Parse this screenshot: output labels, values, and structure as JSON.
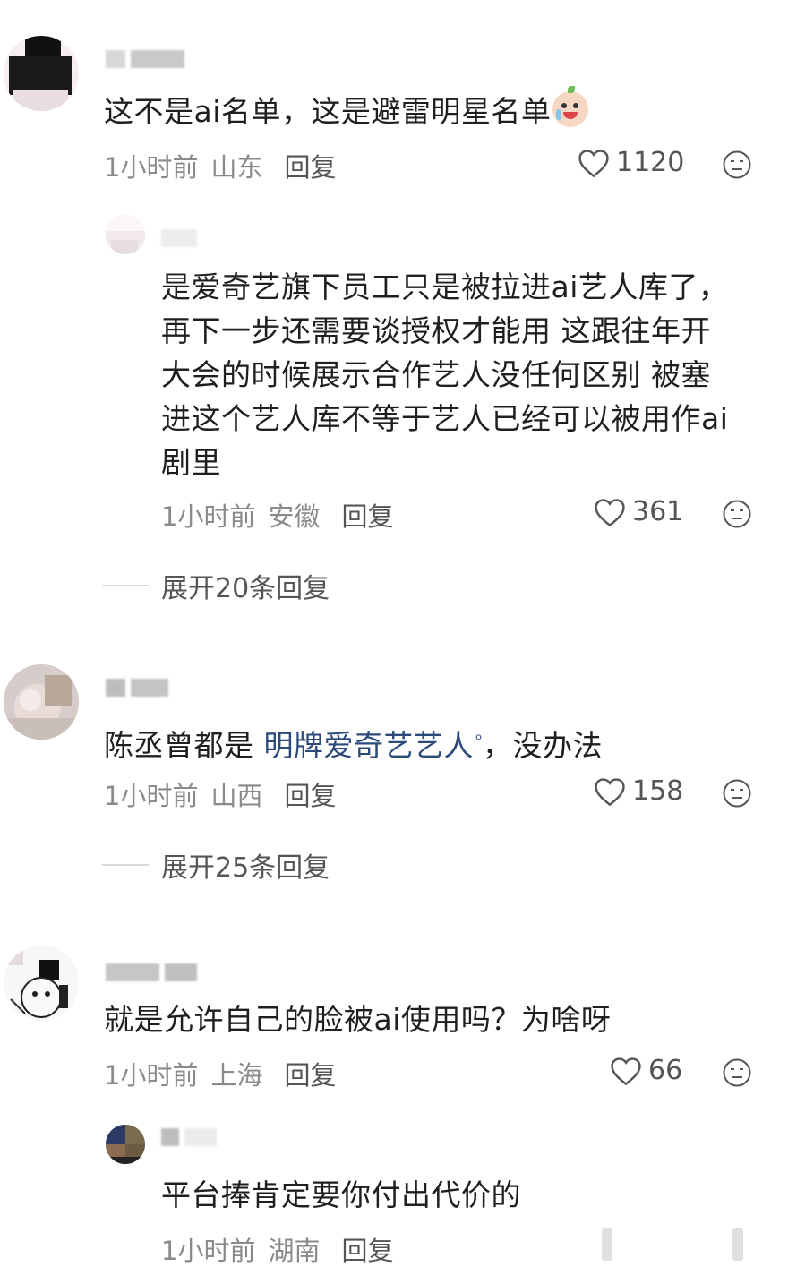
{
  "comments": [
    {
      "text": "这不是ai名单，这是避雷明星名单",
      "emoji": "crying-emoji",
      "time": "1小时前",
      "location": "山东",
      "reply_label": "回复",
      "likes": "1120",
      "replies": [
        {
          "text_lines": [
            "是爱奇艺旗下员工只是被拉进ai艺人库了，",
            "再下一步还需要谈授权才能用 这跟往年开",
            "大会的时候展示合作艺人没任何区别 被塞",
            "进这个艺人库不等于艺人已经可以被用作ai",
            "剧里"
          ],
          "time": "1小时前",
          "location": "安徽",
          "reply_label": "回复",
          "likes": "361"
        }
      ],
      "expand_label": "展开20条回复"
    },
    {
      "text_before": "陈丞曾都是 ",
      "link_text": "明牌爱奇艺艺人",
      "text_after": "，没办法",
      "time": "1小时前",
      "location": "山西",
      "reply_label": "回复",
      "likes": "158",
      "expand_label": "展开25条回复"
    },
    {
      "text": "就是允许自己的脸被ai使用吗？为啥呀",
      "time": "1小时前",
      "location": "上海",
      "reply_label": "回复",
      "likes": "66",
      "replies": [
        {
          "text": "平台捧肯定要你付出代价的",
          "time": "1小时前",
          "location": "湖南",
          "reply_label": "回复"
        }
      ]
    }
  ]
}
